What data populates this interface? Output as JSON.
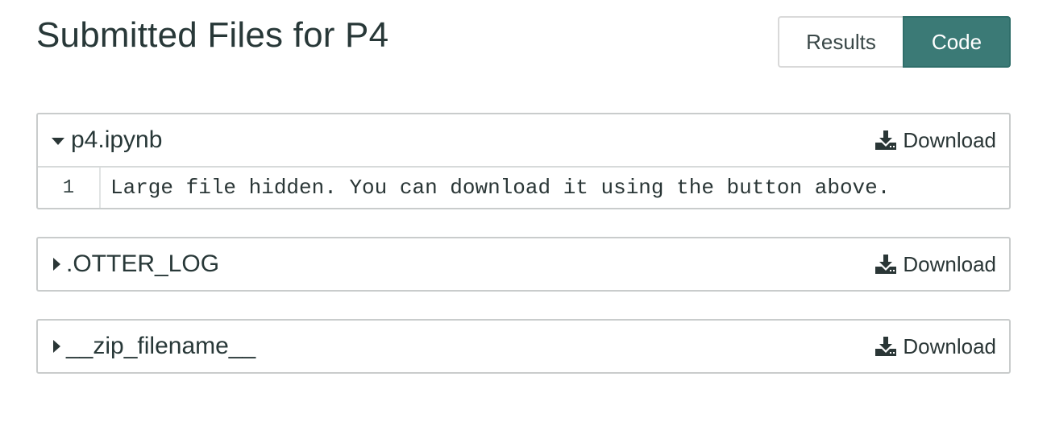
{
  "page": {
    "title": "Submitted Files for P4"
  },
  "view_toggle": {
    "results_label": "Results",
    "code_label": "Code",
    "active": "Code"
  },
  "colors": {
    "accent": "#3b7a76",
    "text": "#283838",
    "border": "#c9cccc"
  },
  "files": [
    {
      "name": "p4.ipynb",
      "expanded": true,
      "caret_icon": "caret-down-icon",
      "download_icon": "download-icon",
      "download_label": "Download",
      "lines": [
        {
          "number": "1",
          "text": "Large file hidden. You can download it using the button above."
        }
      ]
    },
    {
      "name": ".OTTER_LOG",
      "expanded": false,
      "caret_icon": "caret-right-icon",
      "download_icon": "download-icon",
      "download_label": "Download"
    },
    {
      "name": "__zip_filename__",
      "expanded": false,
      "caret_icon": "caret-right-icon",
      "download_icon": "download-icon",
      "download_label": "Download"
    }
  ]
}
